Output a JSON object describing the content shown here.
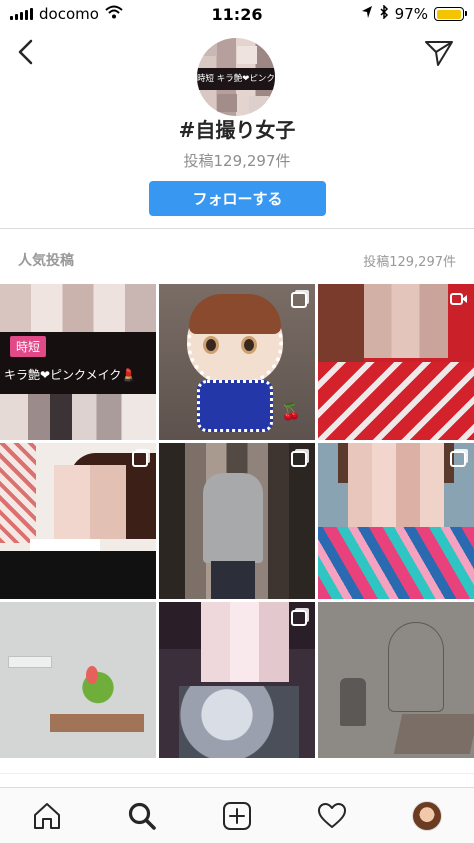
{
  "status_bar": {
    "carrier": "docomo",
    "time": "11:26",
    "battery": "97%",
    "battery_level": 0.97,
    "battery_color": "#f5c400"
  },
  "header": {
    "back_icon": "chevron-left-icon",
    "share_icon": "paper-plane-icon",
    "tag_name": "#自撮り女子",
    "post_count": "投稿129,297件",
    "follow_label": "フォローする",
    "follow_color": "#3897f0",
    "avatar_text": "時短 キラ艶❤ピンクメイク"
  },
  "top_posts": {
    "title": "人気投稿",
    "count": "投稿129,297件"
  },
  "posts": [
    {
      "type": "image",
      "overlay_badge": "時短",
      "overlay_text": "キラ艶❤ピンクメイク💄"
    },
    {
      "type": "multi"
    },
    {
      "type": "video"
    },
    {
      "type": "multi"
    },
    {
      "type": "multi"
    },
    {
      "type": "multi"
    },
    {
      "type": "image"
    },
    {
      "type": "multi"
    },
    {
      "type": "image"
    }
  ],
  "tab_bar": {
    "items": [
      "home-icon",
      "search-icon",
      "add-post-icon",
      "heart-icon",
      "profile-avatar"
    ],
    "active": "search-icon"
  }
}
